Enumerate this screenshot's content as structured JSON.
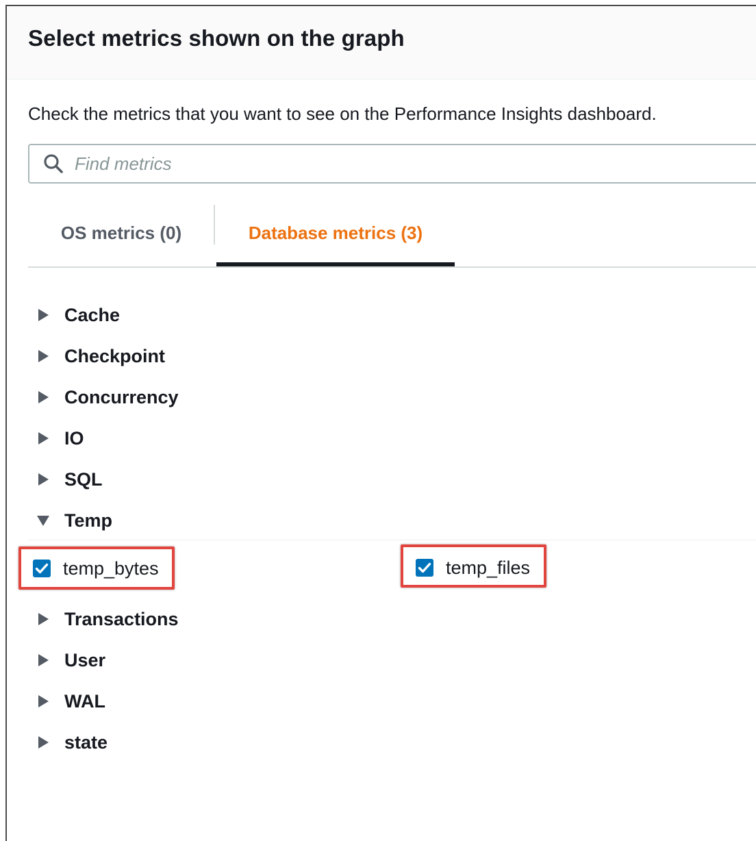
{
  "dialog": {
    "title": "Select metrics shown on the graph",
    "description": "Check the metrics that you want to see on the Performance Insights dashboard."
  },
  "search": {
    "placeholder": "Find metrics",
    "value": "",
    "icon": "search-icon"
  },
  "tabs": [
    {
      "label": "OS metrics (0)",
      "active": false
    },
    {
      "label": "Database metrics (3)",
      "active": true
    }
  ],
  "categories": [
    {
      "label": "Cache",
      "expanded": false
    },
    {
      "label": "Checkpoint",
      "expanded": false
    },
    {
      "label": "Concurrency",
      "expanded": false
    },
    {
      "label": "IO",
      "expanded": false
    },
    {
      "label": "SQL",
      "expanded": false
    },
    {
      "label": "Temp",
      "expanded": true
    },
    {
      "label": "Transactions",
      "expanded": false
    },
    {
      "label": "User",
      "expanded": false
    },
    {
      "label": "WAL",
      "expanded": false
    },
    {
      "label": "state",
      "expanded": false
    }
  ],
  "temp_metrics": [
    {
      "label": "temp_bytes",
      "checked": true
    },
    {
      "label": "temp_files",
      "checked": true
    }
  ],
  "colors": {
    "active_tab": "#ec7211",
    "checkbox": "#0073bb",
    "highlight": "#e2453e"
  }
}
